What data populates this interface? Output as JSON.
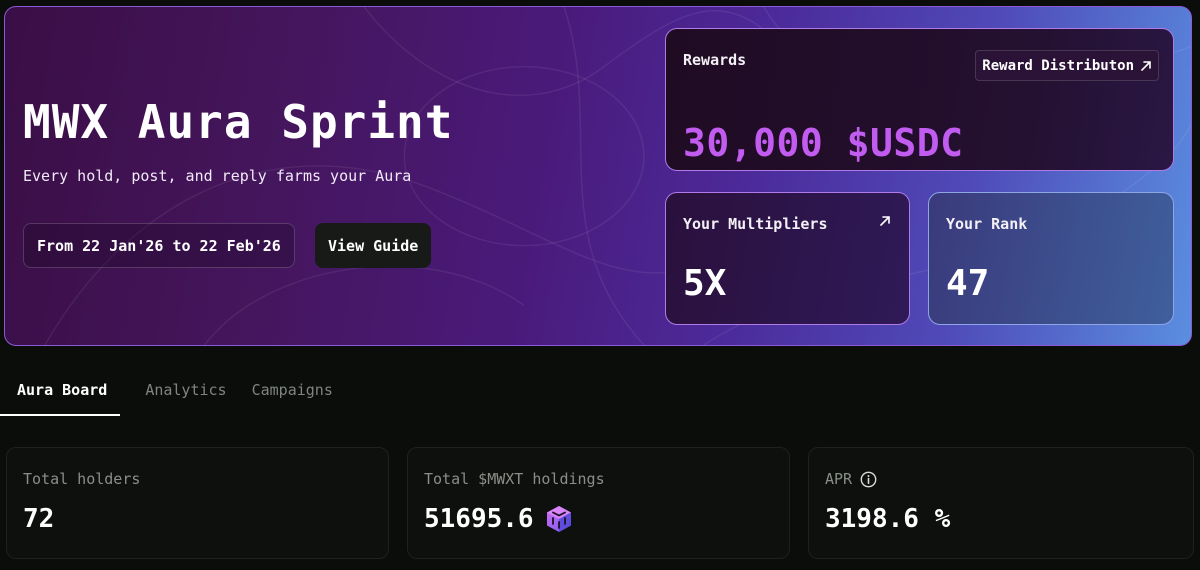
{
  "hero": {
    "title": "MWX Aura Sprint",
    "subtitle": "Every hold, post, and reply farms your Aura",
    "date_range": "From 22 Jan'26 to 22 Feb'26",
    "guide_button": "View Guide"
  },
  "rewards": {
    "label": "Rewards",
    "distribution_button": "Reward Distributon",
    "distribution_icon": "arrow-up-right-icon",
    "value": "30,000 $USDC",
    "accent_color": "#c25cf0"
  },
  "multipliers": {
    "label": "Your Multipliers",
    "icon": "arrow-up-right-icon",
    "value": "5X"
  },
  "rank": {
    "label": "Your Rank",
    "value": "47"
  },
  "tabs": [
    {
      "label": "Aura Board",
      "active": true
    },
    {
      "label": "Analytics",
      "active": false
    },
    {
      "label": "Campaigns",
      "active": false
    }
  ],
  "stats": [
    {
      "label": "Total holders",
      "value": "72"
    },
    {
      "label": "Total $MWXT holdings",
      "value": "51695.6",
      "icon": "token-cube-icon"
    },
    {
      "label": "APR",
      "value": "3198.6 %",
      "icon": "info-icon"
    }
  ]
}
